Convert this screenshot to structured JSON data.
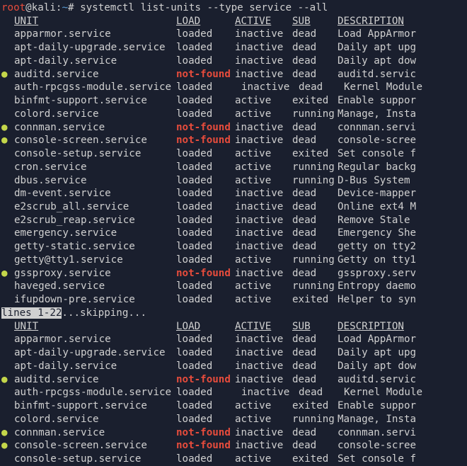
{
  "prompt": {
    "user": "root",
    "host": "kali",
    "path": "~",
    "symbol": "#",
    "command": "systemctl list-units --type service --all"
  },
  "headers": {
    "unit": "UNIT",
    "load": "LOAD",
    "active": "ACTIVE",
    "sub": "SUB",
    "desc": "DESCRIPTION"
  },
  "pager": {
    "text": "lines 1-22",
    "skip": "...skipping..."
  },
  "rows1": [
    {
      "b": "",
      "unit": "apparmor.service",
      "load": "loaded",
      "active": "inactive",
      "sub": "dead",
      "desc": "Load AppArmor",
      "nf": false,
      "sh": false
    },
    {
      "b": "",
      "unit": "apt-daily-upgrade.service",
      "load": "loaded",
      "active": "inactive",
      "sub": "dead",
      "desc": "Daily apt upg",
      "nf": false,
      "sh": false
    },
    {
      "b": "",
      "unit": "apt-daily.service",
      "load": "loaded",
      "active": "inactive",
      "sub": "dead",
      "desc": "Daily apt dow",
      "nf": false,
      "sh": false
    },
    {
      "b": "●",
      "unit": "auditd.service",
      "load": "not-found",
      "active": "inactive",
      "sub": "dead",
      "desc": "auditd.servic",
      "nf": true,
      "sh": false
    },
    {
      "b": "",
      "unit": "auth-rpcgss-module.service",
      "load": "loaded",
      "active": "inactive",
      "sub": "dead",
      "desc": "Kernel Module",
      "nf": false,
      "sh": true
    },
    {
      "b": "",
      "unit": "binfmt-support.service",
      "load": "loaded",
      "active": "active",
      "sub": "exited",
      "desc": "Enable suppor",
      "nf": false,
      "sh": false
    },
    {
      "b": "",
      "unit": "colord.service",
      "load": "loaded",
      "active": "active",
      "sub": "running",
      "desc": "Manage, Insta",
      "nf": false,
      "sh": false
    },
    {
      "b": "●",
      "unit": "connman.service",
      "load": "not-found",
      "active": "inactive",
      "sub": "dead",
      "desc": "connman.servi",
      "nf": true,
      "sh": false
    },
    {
      "b": "●",
      "unit": "console-screen.service",
      "load": "not-found",
      "active": "inactive",
      "sub": "dead",
      "desc": "console-scree",
      "nf": true,
      "sh": false
    },
    {
      "b": "",
      "unit": "console-setup.service",
      "load": "loaded",
      "active": "active",
      "sub": "exited",
      "desc": "Set console f",
      "nf": false,
      "sh": false
    },
    {
      "b": "",
      "unit": "cron.service",
      "load": "loaded",
      "active": "active",
      "sub": "running",
      "desc": "Regular backg",
      "nf": false,
      "sh": false
    },
    {
      "b": "",
      "unit": "dbus.service",
      "load": "loaded",
      "active": "active",
      "sub": "running",
      "desc": "D-Bus System",
      "nf": false,
      "sh": false
    },
    {
      "b": "",
      "unit": "dm-event.service",
      "load": "loaded",
      "active": "inactive",
      "sub": "dead",
      "desc": "Device-mapper",
      "nf": false,
      "sh": false
    },
    {
      "b": "",
      "unit": "e2scrub_all.service",
      "load": "loaded",
      "active": "inactive",
      "sub": "dead",
      "desc": "Online ext4 M",
      "nf": false,
      "sh": false
    },
    {
      "b": "",
      "unit": "e2scrub_reap.service",
      "load": "loaded",
      "active": "inactive",
      "sub": "dead",
      "desc": "Remove Stale",
      "nf": false,
      "sh": false
    },
    {
      "b": "",
      "unit": "emergency.service",
      "load": "loaded",
      "active": "inactive",
      "sub": "dead",
      "desc": "Emergency She",
      "nf": false,
      "sh": false
    },
    {
      "b": "",
      "unit": "getty-static.service",
      "load": "loaded",
      "active": "inactive",
      "sub": "dead",
      "desc": "getty on tty2",
      "nf": false,
      "sh": false
    },
    {
      "b": "",
      "unit": "getty@tty1.service",
      "load": "loaded",
      "active": "active",
      "sub": "running",
      "desc": "Getty on tty1",
      "nf": false,
      "sh": false
    },
    {
      "b": "●",
      "unit": "gssproxy.service",
      "load": "not-found",
      "active": "inactive",
      "sub": "dead",
      "desc": "gssproxy.serv",
      "nf": true,
      "sh": false
    },
    {
      "b": "",
      "unit": "haveged.service",
      "load": "loaded",
      "active": "active",
      "sub": "running",
      "desc": "Entropy daemo",
      "nf": false,
      "sh": false
    },
    {
      "b": "",
      "unit": "ifupdown-pre.service",
      "load": "loaded",
      "active": "active",
      "sub": "exited",
      "desc": "Helper to syn",
      "nf": false,
      "sh": false
    }
  ],
  "rows2": [
    {
      "b": "",
      "unit": "apparmor.service",
      "load": "loaded",
      "active": "inactive",
      "sub": "dead",
      "desc": "Load AppArmor",
      "nf": false,
      "sh": false
    },
    {
      "b": "",
      "unit": "apt-daily-upgrade.service",
      "load": "loaded",
      "active": "inactive",
      "sub": "dead",
      "desc": "Daily apt upg",
      "nf": false,
      "sh": false
    },
    {
      "b": "",
      "unit": "apt-daily.service",
      "load": "loaded",
      "active": "inactive",
      "sub": "dead",
      "desc": "Daily apt dow",
      "nf": false,
      "sh": false
    },
    {
      "b": "●",
      "unit": "auditd.service",
      "load": "not-found",
      "active": "inactive",
      "sub": "dead",
      "desc": "auditd.servic",
      "nf": true,
      "sh": false
    },
    {
      "b": "",
      "unit": "auth-rpcgss-module.service",
      "load": "loaded",
      "active": "inactive",
      "sub": "dead",
      "desc": "Kernel Module",
      "nf": false,
      "sh": true
    },
    {
      "b": "",
      "unit": "binfmt-support.service",
      "load": "loaded",
      "active": "active",
      "sub": "exited",
      "desc": "Enable suppor",
      "nf": false,
      "sh": false
    },
    {
      "b": "",
      "unit": "colord.service",
      "load": "loaded",
      "active": "active",
      "sub": "running",
      "desc": "Manage, Insta",
      "nf": false,
      "sh": false
    },
    {
      "b": "●",
      "unit": "connman.service",
      "load": "not-found",
      "active": "inactive",
      "sub": "dead",
      "desc": "connman.servi",
      "nf": true,
      "sh": false
    },
    {
      "b": "●",
      "unit": "console-screen.service",
      "load": "not-found",
      "active": "inactive",
      "sub": "dead",
      "desc": "console-scree",
      "nf": true,
      "sh": false
    },
    {
      "b": "",
      "unit": "console-setup.service",
      "load": "loaded",
      "active": "active",
      "sub": "exited",
      "desc": "Set console f",
      "nf": false,
      "sh": false
    }
  ]
}
